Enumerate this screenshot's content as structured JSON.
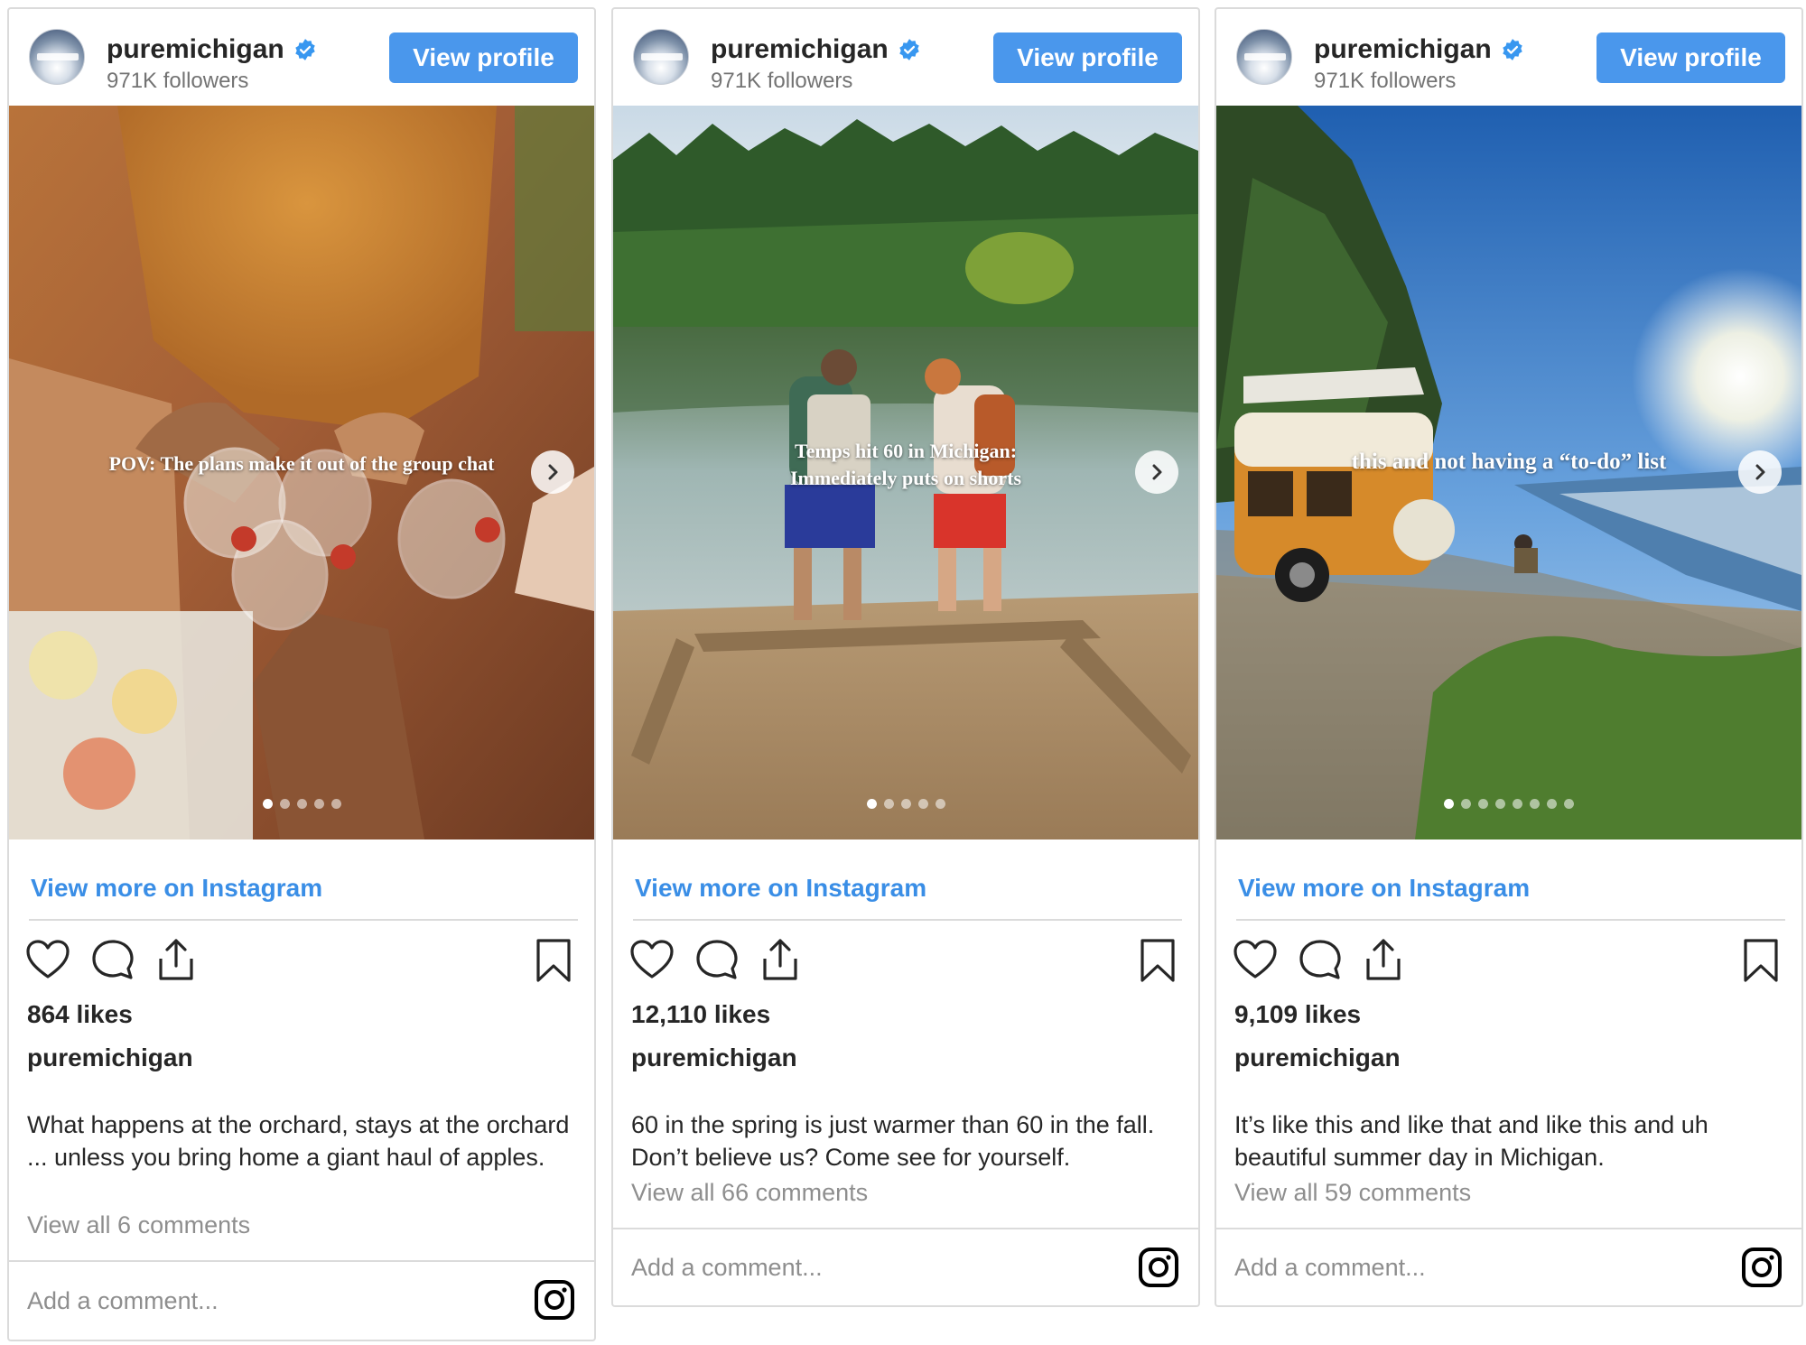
{
  "cards": [
    {
      "username": "puremichigan",
      "followers": "971K followers",
      "view_profile_label": "View profile",
      "overlay_caption": "POV: The plans make it out of the group chat",
      "slide_count": 5,
      "active_slide": 1,
      "view_more_label": "View more on Instagram",
      "likes": "864 likes",
      "caption_user": "puremichigan",
      "caption": "What happens at the orchard, stays at the orchard ... unless you bring home a giant haul of apples.",
      "comments_link": "View all 6 comments",
      "comment_placeholder": "Add a comment..."
    },
    {
      "username": "puremichigan",
      "followers": "971K followers",
      "view_profile_label": "View profile",
      "overlay_caption_line1": "Temps hit 60 in Michigan:",
      "overlay_caption_line2": "Immediately puts on shorts",
      "slide_count": 5,
      "active_slide": 1,
      "view_more_label": "View more on Instagram",
      "likes": "12,110 likes",
      "caption_user": "puremichigan",
      "caption": "60 in the spring is just warmer than 60 in the fall. Don’t believe us? Come see for yourself.",
      "comments_link": "View all 66 comments",
      "comment_placeholder": "Add a comment..."
    },
    {
      "username": "puremichigan",
      "followers": "971K followers",
      "view_profile_label": "View profile",
      "overlay_caption": "this and not having a “to-do” list",
      "slide_count": 8,
      "active_slide": 1,
      "view_more_label": "View more on Instagram",
      "likes": "9,109 likes",
      "caption_user": "puremichigan",
      "caption": "It’s like this and like that and like this and uh beautiful summer day in Michigan.",
      "comments_link": "View all 59 comments",
      "comment_placeholder": "Add a comment..."
    }
  ],
  "icons": {
    "header": [
      "avatar",
      "verified-badge-icon"
    ],
    "image": [
      "next-arrow-icon"
    ],
    "actions": [
      "heart-icon",
      "comment-icon",
      "share-icon",
      "bookmark-icon"
    ],
    "footer": [
      "instagram-icon"
    ]
  },
  "colors": {
    "button_blue": "#4a97ec",
    "link_blue": "#3a8ee6",
    "border": "#dbdbdb",
    "secondary_text": "#8e8e8e",
    "verified_blue": "#3897f0"
  }
}
